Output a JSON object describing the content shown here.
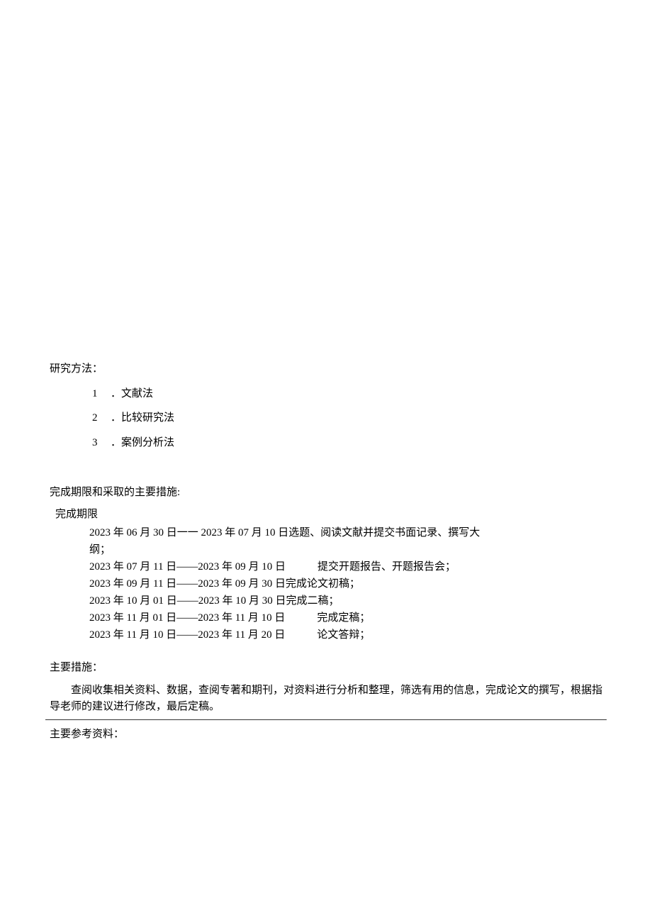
{
  "methods": {
    "heading": "研究方法：",
    "items": [
      {
        "num": "1",
        "text": "．文献法"
      },
      {
        "num": "2",
        "text": "．比较研究法"
      },
      {
        "num": "3",
        "text": "．案例分析法"
      }
    ]
  },
  "schedule": {
    "heading": "完成期限和采取的主要措施:",
    "sub_heading": "完成期限",
    "rows": [
      "2023 年 06 月 30 日一一 2023 年 07 月 10 日选题、阅读文献并提交书面记录、撰写大",
      "纲；",
      "2023 年 07 月 11 日——2023 年 09 月 10 日   提交开题报告、开题报告会；",
      "2023 年 09 月 11 日——2023 年 09 月 30 日完成论文初稿；",
      "2023 年 10 月 01 日——2023 年 10 月 30 日完成二稿；",
      "2023 年 11 月 01 日——2023 年 11 月 10 日   完成定稿；",
      "2023 年 11 月 10 日——2023 年 11 月 20 日   论文答辩；"
    ]
  },
  "measures": {
    "heading": "主要措施：",
    "body": "查阅收集相关资料、数据，查阅专著和期刊，对资料进行分析和整理，筛选有用的信息，完成论文的撰写，根据指导老师的建议进行修改，最后定稿。"
  },
  "references": {
    "heading": "主要参考资料："
  }
}
